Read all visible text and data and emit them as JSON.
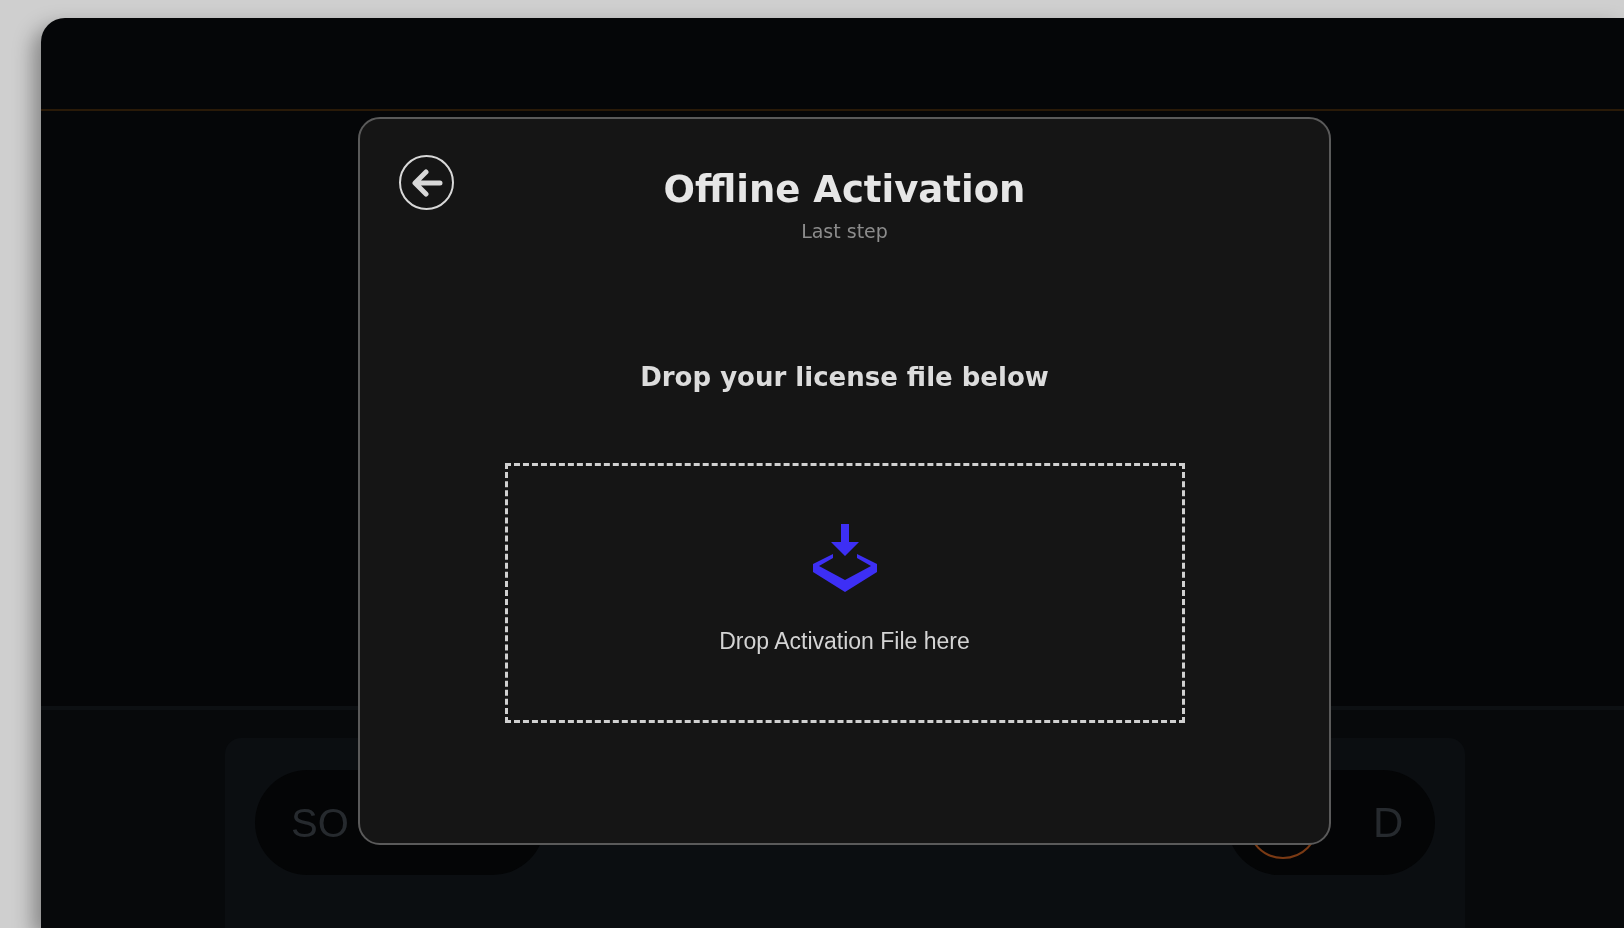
{
  "background": {
    "left_pill": {
      "label": "SO"
    },
    "right_pill": {
      "label": "D"
    }
  },
  "dialog": {
    "title": "Offline Activation",
    "subtitle": "Last step",
    "instruction": "Drop your license file below",
    "dropzone": {
      "label": "Drop Activation File here"
    }
  }
}
